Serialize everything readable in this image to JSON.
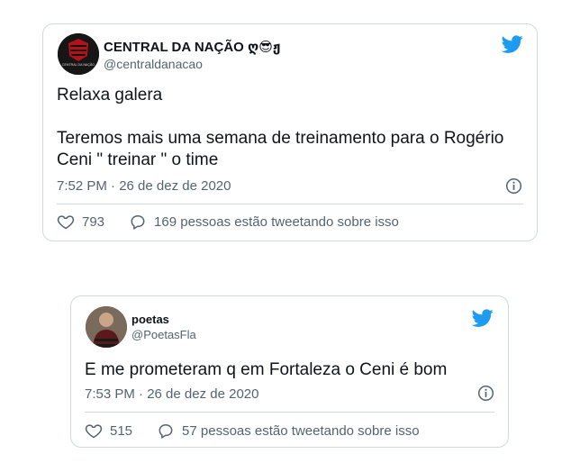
{
  "tweets": [
    {
      "display_name": "CENTRAL DA NAÇÃO ღ😎ჟ",
      "handle": "@centraldanacao",
      "lines": [
        "Relaxa galera",
        "",
        "Teremos mais uma semana de treinamento para o Rogério Ceni \" treinar \" o time"
      ],
      "timestamp": "7:52 PM · 26 de dez de 2020",
      "likes": "793",
      "talking": "169 pessoas estão tweetando sobre isso",
      "avatar_text": "CENTRAL DA NAÇÃO"
    },
    {
      "display_name": "poetas",
      "handle": "@PoetasFla",
      "lines": [
        "E me prometeram q em Fortaleza o Ceni é bom"
      ],
      "timestamp": "7:53 PM · 26 de dez de 2020",
      "likes": "515",
      "talking": "57 pessoas estão tweetando sobre isso"
    }
  ],
  "colors": {
    "twitter_blue": "#1d9bf0",
    "muted": "#536471",
    "border": "#cfd9de"
  },
  "icons": [
    "twitter-bird-icon",
    "info-icon",
    "heart-icon",
    "reply-bubble-icon"
  ]
}
